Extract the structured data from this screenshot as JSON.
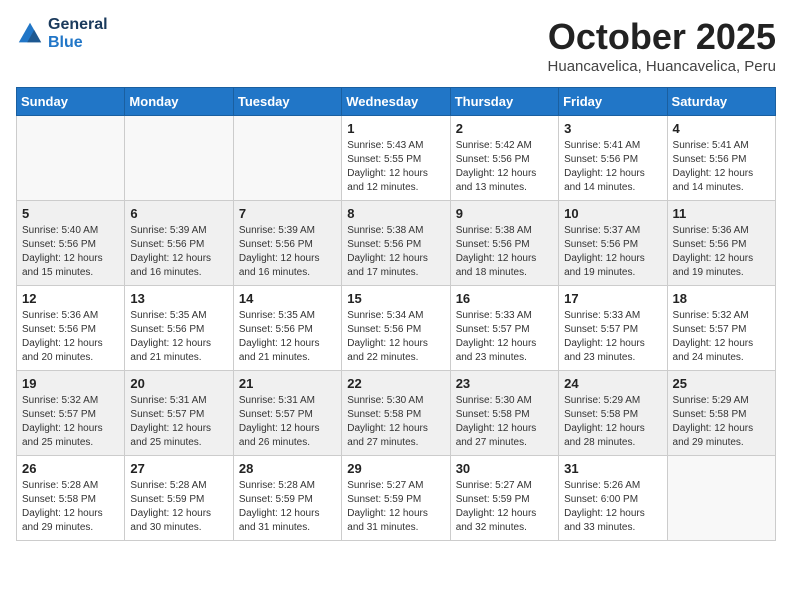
{
  "header": {
    "logo_line1": "General",
    "logo_line2": "Blue",
    "month": "October 2025",
    "location": "Huancavelica, Huancavelica, Peru"
  },
  "weekdays": [
    "Sunday",
    "Monday",
    "Tuesday",
    "Wednesday",
    "Thursday",
    "Friday",
    "Saturday"
  ],
  "weeks": [
    [
      {
        "day": "",
        "sunrise": "",
        "sunset": "",
        "daylight": "",
        "empty": true
      },
      {
        "day": "",
        "sunrise": "",
        "sunset": "",
        "daylight": "",
        "empty": true
      },
      {
        "day": "",
        "sunrise": "",
        "sunset": "",
        "daylight": "",
        "empty": true
      },
      {
        "day": "1",
        "sunrise": "Sunrise: 5:43 AM",
        "sunset": "Sunset: 5:55 PM",
        "daylight": "Daylight: 12 hours and 12 minutes."
      },
      {
        "day": "2",
        "sunrise": "Sunrise: 5:42 AM",
        "sunset": "Sunset: 5:56 PM",
        "daylight": "Daylight: 12 hours and 13 minutes."
      },
      {
        "day": "3",
        "sunrise": "Sunrise: 5:41 AM",
        "sunset": "Sunset: 5:56 PM",
        "daylight": "Daylight: 12 hours and 14 minutes."
      },
      {
        "day": "4",
        "sunrise": "Sunrise: 5:41 AM",
        "sunset": "Sunset: 5:56 PM",
        "daylight": "Daylight: 12 hours and 14 minutes."
      }
    ],
    [
      {
        "day": "5",
        "sunrise": "Sunrise: 5:40 AM",
        "sunset": "Sunset: 5:56 PM",
        "daylight": "Daylight: 12 hours and 15 minutes."
      },
      {
        "day": "6",
        "sunrise": "Sunrise: 5:39 AM",
        "sunset": "Sunset: 5:56 PM",
        "daylight": "Daylight: 12 hours and 16 minutes."
      },
      {
        "day": "7",
        "sunrise": "Sunrise: 5:39 AM",
        "sunset": "Sunset: 5:56 PM",
        "daylight": "Daylight: 12 hours and 16 minutes."
      },
      {
        "day": "8",
        "sunrise": "Sunrise: 5:38 AM",
        "sunset": "Sunset: 5:56 PM",
        "daylight": "Daylight: 12 hours and 17 minutes."
      },
      {
        "day": "9",
        "sunrise": "Sunrise: 5:38 AM",
        "sunset": "Sunset: 5:56 PM",
        "daylight": "Daylight: 12 hours and 18 minutes."
      },
      {
        "day": "10",
        "sunrise": "Sunrise: 5:37 AM",
        "sunset": "Sunset: 5:56 PM",
        "daylight": "Daylight: 12 hours and 19 minutes."
      },
      {
        "day": "11",
        "sunrise": "Sunrise: 5:36 AM",
        "sunset": "Sunset: 5:56 PM",
        "daylight": "Daylight: 12 hours and 19 minutes."
      }
    ],
    [
      {
        "day": "12",
        "sunrise": "Sunrise: 5:36 AM",
        "sunset": "Sunset: 5:56 PM",
        "daylight": "Daylight: 12 hours and 20 minutes."
      },
      {
        "day": "13",
        "sunrise": "Sunrise: 5:35 AM",
        "sunset": "Sunset: 5:56 PM",
        "daylight": "Daylight: 12 hours and 21 minutes."
      },
      {
        "day": "14",
        "sunrise": "Sunrise: 5:35 AM",
        "sunset": "Sunset: 5:56 PM",
        "daylight": "Daylight: 12 hours and 21 minutes."
      },
      {
        "day": "15",
        "sunrise": "Sunrise: 5:34 AM",
        "sunset": "Sunset: 5:56 PM",
        "daylight": "Daylight: 12 hours and 22 minutes."
      },
      {
        "day": "16",
        "sunrise": "Sunrise: 5:33 AM",
        "sunset": "Sunset: 5:57 PM",
        "daylight": "Daylight: 12 hours and 23 minutes."
      },
      {
        "day": "17",
        "sunrise": "Sunrise: 5:33 AM",
        "sunset": "Sunset: 5:57 PM",
        "daylight": "Daylight: 12 hours and 23 minutes."
      },
      {
        "day": "18",
        "sunrise": "Sunrise: 5:32 AM",
        "sunset": "Sunset: 5:57 PM",
        "daylight": "Daylight: 12 hours and 24 minutes."
      }
    ],
    [
      {
        "day": "19",
        "sunrise": "Sunrise: 5:32 AM",
        "sunset": "Sunset: 5:57 PM",
        "daylight": "Daylight: 12 hours and 25 minutes."
      },
      {
        "day": "20",
        "sunrise": "Sunrise: 5:31 AM",
        "sunset": "Sunset: 5:57 PM",
        "daylight": "Daylight: 12 hours and 25 minutes."
      },
      {
        "day": "21",
        "sunrise": "Sunrise: 5:31 AM",
        "sunset": "Sunset: 5:57 PM",
        "daylight": "Daylight: 12 hours and 26 minutes."
      },
      {
        "day": "22",
        "sunrise": "Sunrise: 5:30 AM",
        "sunset": "Sunset: 5:58 PM",
        "daylight": "Daylight: 12 hours and 27 minutes."
      },
      {
        "day": "23",
        "sunrise": "Sunrise: 5:30 AM",
        "sunset": "Sunset: 5:58 PM",
        "daylight": "Daylight: 12 hours and 27 minutes."
      },
      {
        "day": "24",
        "sunrise": "Sunrise: 5:29 AM",
        "sunset": "Sunset: 5:58 PM",
        "daylight": "Daylight: 12 hours and 28 minutes."
      },
      {
        "day": "25",
        "sunrise": "Sunrise: 5:29 AM",
        "sunset": "Sunset: 5:58 PM",
        "daylight": "Daylight: 12 hours and 29 minutes."
      }
    ],
    [
      {
        "day": "26",
        "sunrise": "Sunrise: 5:28 AM",
        "sunset": "Sunset: 5:58 PM",
        "daylight": "Daylight: 12 hours and 29 minutes."
      },
      {
        "day": "27",
        "sunrise": "Sunrise: 5:28 AM",
        "sunset": "Sunset: 5:59 PM",
        "daylight": "Daylight: 12 hours and 30 minutes."
      },
      {
        "day": "28",
        "sunrise": "Sunrise: 5:28 AM",
        "sunset": "Sunset: 5:59 PM",
        "daylight": "Daylight: 12 hours and 31 minutes."
      },
      {
        "day": "29",
        "sunrise": "Sunrise: 5:27 AM",
        "sunset": "Sunset: 5:59 PM",
        "daylight": "Daylight: 12 hours and 31 minutes."
      },
      {
        "day": "30",
        "sunrise": "Sunrise: 5:27 AM",
        "sunset": "Sunset: 5:59 PM",
        "daylight": "Daylight: 12 hours and 32 minutes."
      },
      {
        "day": "31",
        "sunrise": "Sunrise: 5:26 AM",
        "sunset": "Sunset: 6:00 PM",
        "daylight": "Daylight: 12 hours and 33 minutes."
      },
      {
        "day": "",
        "sunrise": "",
        "sunset": "",
        "daylight": "",
        "empty": true
      }
    ]
  ],
  "shaded_rows": [
    1,
    3
  ],
  "colors": {
    "header_bg": "#2176c7",
    "shaded_row": "#f0f0f0",
    "empty_shaded": "#e8e8e8"
  }
}
